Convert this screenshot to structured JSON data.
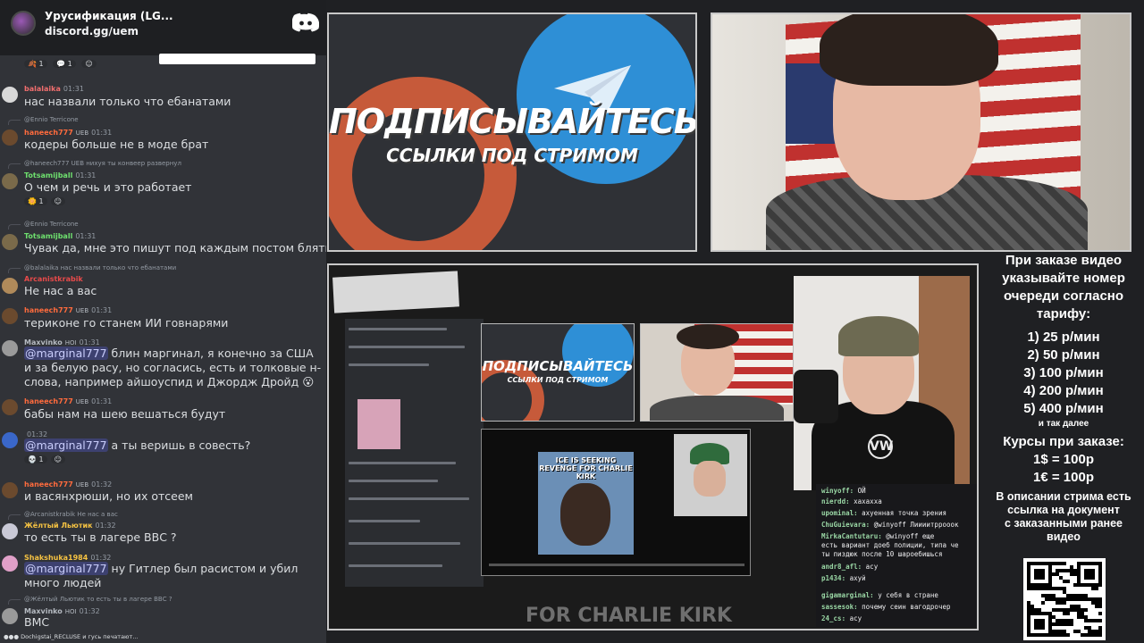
{
  "chat": {
    "server_name": "Урусификация (LG...",
    "server_link": "discord.gg/uem",
    "top_reactions": [
      "1",
      "1"
    ],
    "messages": [
      {
        "user": "balalaika",
        "color": "#f06e6e",
        "time": "01:31",
        "text": "нас назвали только что ебанатами"
      },
      {
        "reply": "@Ennio Terricone",
        "user": "haneech777",
        "color": "#ff6b3d",
        "badge": "UEB",
        "time": "01:31",
        "text": "кодеры больше не в моде брат"
      },
      {
        "reply": "@haneech777 UEB нихуя ты конвеер развернул",
        "user": "Totsamijball",
        "color": "#6ee06e",
        "time": "01:31",
        "text": "О чем и речь и это работает",
        "reactions": [
          "1"
        ]
      },
      {
        "reply": "@Ennio Terricone",
        "user": "Totsamijball",
        "color": "#6ee06e",
        "time": "01:31",
        "text": "Чувак да, мне это пишут под каждым постом блять"
      },
      {
        "reply": "@balalaika нас назвали только что ебанатами",
        "user": "Arcanistkrabik",
        "color": "#e84a4a",
        "time": "",
        "text": "Не нас а вас"
      },
      {
        "user": "haneech777",
        "color": "#ff6b3d",
        "badge": "UEB",
        "time": "01:31",
        "text": "териконе го станем ИИ говнарями"
      },
      {
        "user": "Maxvinko",
        "color": "#b5bac1",
        "badge": "HOI",
        "time": "01:31",
        "mention": "@marginal777",
        "text": " блин маргинал, я конечно за США и за белую расу, но согласись, есть и толковые н-слова, например айшоуспид и Джордж Дройд 😮"
      },
      {
        "user": "haneech777",
        "color": "#ff6b3d",
        "badge": "UEB",
        "time": "01:31",
        "text": "бабы нам на шею вешаться будут"
      },
      {
        "user": "",
        "color": "#b5bac1",
        "time": "01:32",
        "mention": "@marginal777",
        "text": " а ты веришь в совесть?",
        "reactions": [
          "1"
        ]
      },
      {
        "user": "haneech777",
        "color": "#ff6b3d",
        "badge": "UEB",
        "time": "01:32",
        "text": "и васянхрюши, но их отсеем"
      },
      {
        "reply": "@Arcanistkrabik Не нас а вас",
        "user": "Жёлтый Льютик",
        "color": "#f5c242",
        "time": "01:32",
        "text": "то есть ты в лагере ВВС ?"
      },
      {
        "user": "Shakshuka1984",
        "color": "#f5c242",
        "time": "01:32",
        "mention": "@marginal777",
        "text": " ну Гитлер был расистом и убил много людей"
      },
      {
        "reply": "@Жёлтый Льютик то есть ты в лагере ВВС ?",
        "user": "Maxvinko",
        "color": "#b5bac1",
        "badge": "HOI",
        "time": "01:32",
        "text": "ВМС"
      }
    ],
    "typing": "Dochigstai_RECLUSE и гусь печатают..."
  },
  "promo": {
    "title": "ПОДПИСЫВАЙТЕСЬ",
    "subtitle": "ССЫЛКИ ПОД СТРИМОМ"
  },
  "nested": {
    "promo_title": "ПОДПИСЫВАЙТЕСЬ",
    "promo_subtitle": "ССЫЛКИ ПОД СТРИМОМ",
    "clip_text": "ICE IS SEEKING REVENGE FOR CHARLIE KIRK",
    "bottom_caption": "FOR CHARLIE KIRK",
    "vw_logo": "VW",
    "twitch": [
      {
        "user": "winyoff:",
        "text": "ОЙ"
      },
      {
        "user": "nierdd:",
        "text": "хахаххa"
      },
      {
        "user": "upominal:",
        "text": "ахуенная точка зрения"
      },
      {
        "user": "ChuGuievara:",
        "text": "@winyoff Лиииитррооок"
      },
      {
        "user": "MirkaCantutaru:",
        "text": "@winyoff еще"
      },
      {
        "user": "",
        "text": "есть вариант доеб полиции, типа че"
      },
      {
        "user": "",
        "text": "ты пиздюк после 10 шароебишься"
      },
      {
        "user": "andr8_afl:",
        "text": "асу"
      },
      {
        "user": "p1434:",
        "text": "ахуй"
      },
      {
        "user": "gigamarginal:",
        "text": "у себя в стране"
      },
      {
        "user": "sassesok:",
        "text": "почему сеин вагодрочер"
      },
      {
        "user": "24_cs:",
        "text": "асу"
      }
    ]
  },
  "info": {
    "intro": [
      "При заказе видео",
      "указывайте номер",
      "очереди согласно",
      "тарифу:"
    ],
    "tariffs": [
      "1) 25 р/мин",
      "2) 50 р/мин",
      "3) 100 р/мин",
      "4) 200 р/мин",
      "5) 400 р/мин"
    ],
    "etc": "и так далее",
    "rates_title": "Курсы при заказе:",
    "rates": [
      "1$ = 100р",
      "1€ = 100р"
    ],
    "note": [
      "В описании стрима есть",
      "ссылка на документ",
      "с заказанными ранее",
      "видео"
    ]
  },
  "colors": {
    "discord_bg": "#313338",
    "telegram_blue": "#2e8fd6",
    "boosty_orange": "#c65a3a"
  }
}
